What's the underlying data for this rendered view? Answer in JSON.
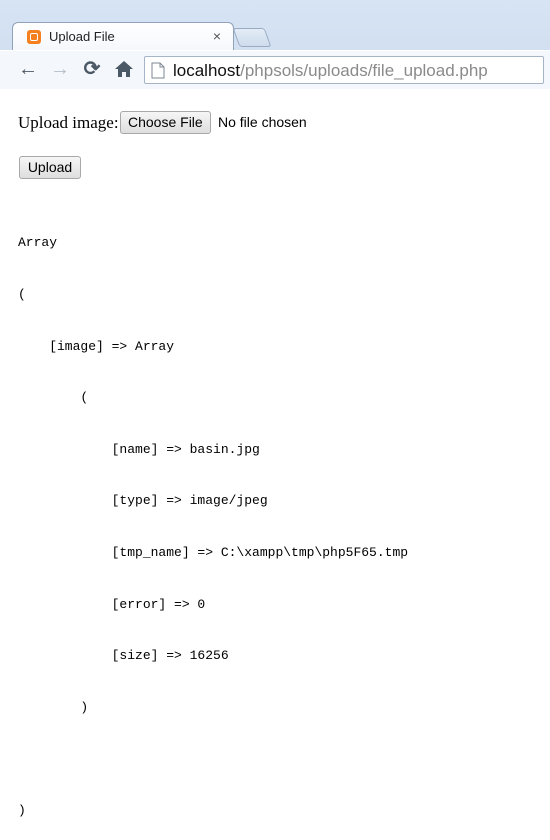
{
  "browser": {
    "tab": {
      "title": "Upload File",
      "close_glyph": "×",
      "favicon": "xampp-icon"
    },
    "nav": {
      "back": "←",
      "forward": "→",
      "reload": "⟳",
      "home": "home-icon"
    },
    "url": {
      "host": "localhost",
      "path": "/phpsols/uploads/file_upload.php"
    }
  },
  "form": {
    "label": "Upload image:",
    "file_button": "Choose File",
    "file_status": "No file chosen",
    "submit_label": "Upload"
  },
  "dump": {
    "lines": [
      "Array",
      "(",
      "    [image] => Array",
      "        (",
      "            [name] => basin.jpg",
      "            [type] => image/jpeg",
      "            [tmp_name] => C:\\xampp\\tmp\\php5F65.tmp",
      "            [error] => 0",
      "            [size] => 16256",
      "        )",
      "",
      ")"
    ]
  }
}
